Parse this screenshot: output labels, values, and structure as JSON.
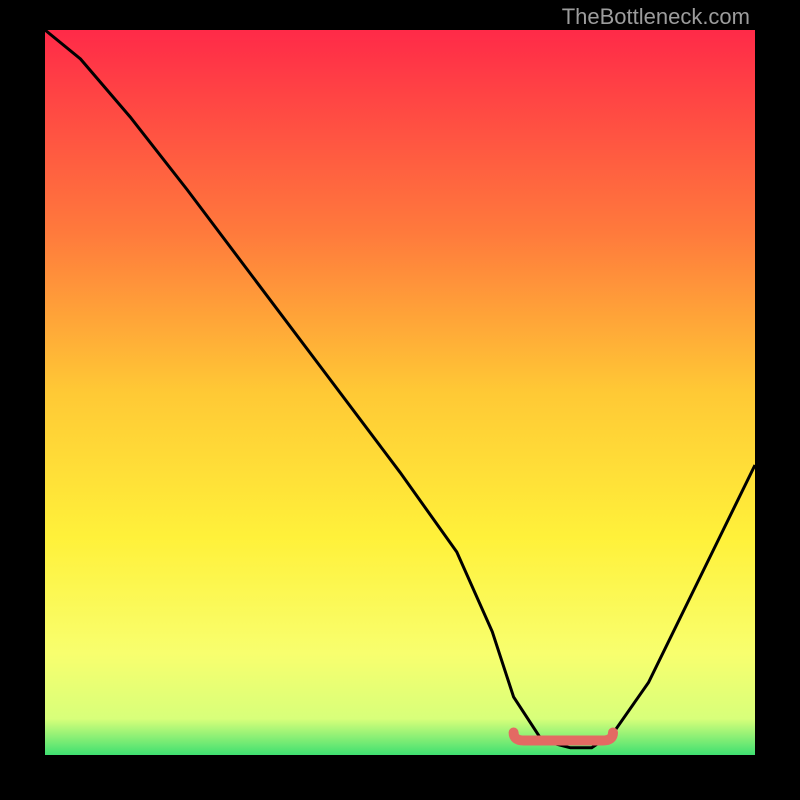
{
  "watermark": "TheBottleneck.com",
  "colors": {
    "top": "#ff2a48",
    "mid_upper": "#ff893b",
    "mid": "#ffd735",
    "mid_lower": "#fff23a",
    "low": "#f9ff70",
    "base": "#3fe071",
    "curve": "#000000",
    "highlight": "#e36a63"
  },
  "chart_data": {
    "type": "line",
    "title": "",
    "xlabel": "",
    "ylabel": "",
    "xlim": [
      0,
      100
    ],
    "ylim": [
      0,
      100
    ],
    "x": [
      0,
      5,
      12,
      20,
      30,
      40,
      50,
      58,
      63,
      66,
      70,
      74,
      77,
      80,
      85,
      90,
      95,
      100
    ],
    "values": [
      100,
      96,
      88,
      78,
      65,
      52,
      39,
      28,
      17,
      8,
      2,
      1,
      1,
      3,
      10,
      20,
      30,
      40
    ],
    "minimum_region": {
      "x_start": 66,
      "x_end": 80,
      "y": 1
    }
  }
}
